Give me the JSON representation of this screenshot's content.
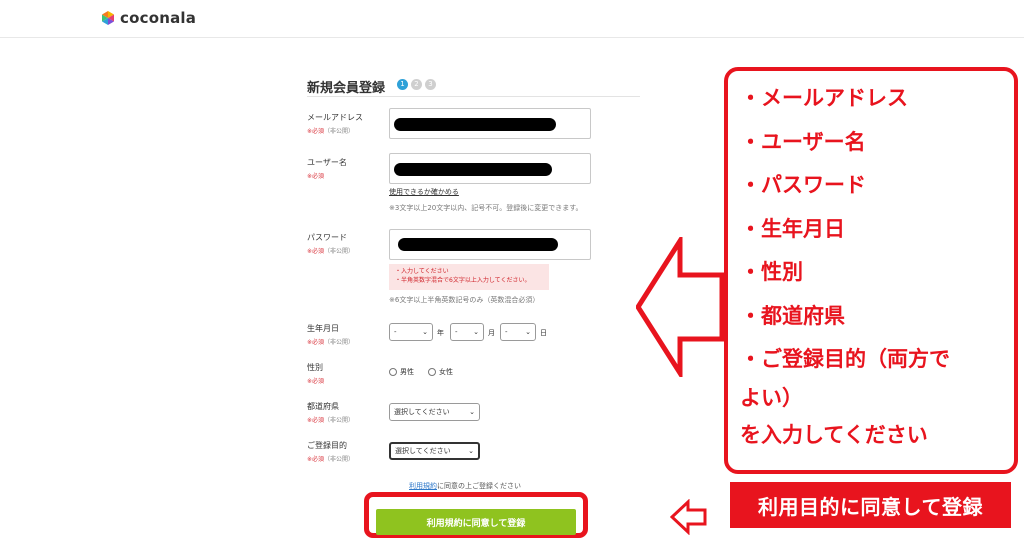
{
  "header": {
    "logo_text": "coconala"
  },
  "form": {
    "title": "新規会員登録",
    "steps": [
      "1",
      "2",
      "3"
    ],
    "required": "※必須",
    "private": "（非公開）",
    "email": {
      "label": "メールアドレス"
    },
    "username": {
      "label": "ユーザー名",
      "check_link": "使用できるか確かめる",
      "hint": "※3文字以上20文字以内、記号不可。登録後に変更できます。"
    },
    "password": {
      "label": "パスワード",
      "errors": [
        "・入力してください",
        "・半角英数字混合で6文字以上入力してください。"
      ],
      "hint": "※6文字以上半角英数記号のみ（英数混合必須）"
    },
    "birthdate": {
      "label": "生年月日",
      "year_value": "-",
      "year_unit": "年",
      "month_value": "-",
      "month_unit": "月",
      "day_value": "-",
      "day_unit": "日"
    },
    "gender": {
      "label": "性別",
      "male": "男性",
      "female": "女性"
    },
    "prefecture": {
      "label": "都道府県",
      "value": "選択してください"
    },
    "purpose": {
      "label": "ご登録目的",
      "value": "選択してください"
    },
    "agree_link": "利用規約",
    "agree_text": "に同意の上ご登録ください",
    "submit_label": "利用規約に同意して登録"
  },
  "callout": {
    "lines": [
      "・メールアドレス",
      "・ユーザー名",
      "・パスワード",
      "・生年月日",
      "・性別",
      "・都道府県",
      "・ご登録目的（両方で",
      "よい）",
      "を入力してください"
    ]
  },
  "banner": {
    "text": "利用目的に同意して登録"
  },
  "colors": {
    "accent_red": "#e8141e",
    "submit_green": "#8fc31f",
    "step_blue": "#2fa1d8"
  }
}
